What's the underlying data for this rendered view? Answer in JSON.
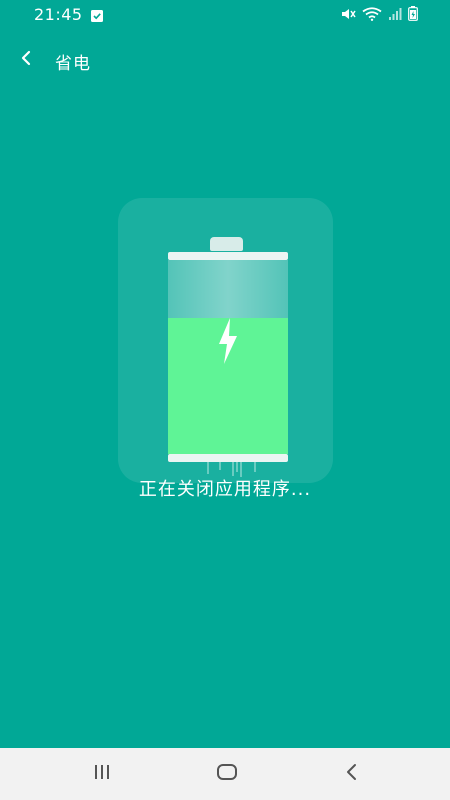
{
  "status_bar": {
    "time": "21:45",
    "icons": [
      "notification-check-icon",
      "mute-icon",
      "wifi-icon",
      "signal-icon",
      "battery-icon"
    ]
  },
  "app_bar": {
    "back_icon": "chevron-left-icon",
    "title": "省电"
  },
  "battery": {
    "charge_fraction": 0.7,
    "icon": "lightning-bolt-icon",
    "accent_color": "#5ff496"
  },
  "status_message": "正在关闭应用程序...",
  "nav_bar": {
    "buttons": [
      "recent-apps-icon",
      "home-icon",
      "back-icon"
    ]
  },
  "colors": {
    "background": "#01a896",
    "nav_background": "#f2f2f2"
  }
}
